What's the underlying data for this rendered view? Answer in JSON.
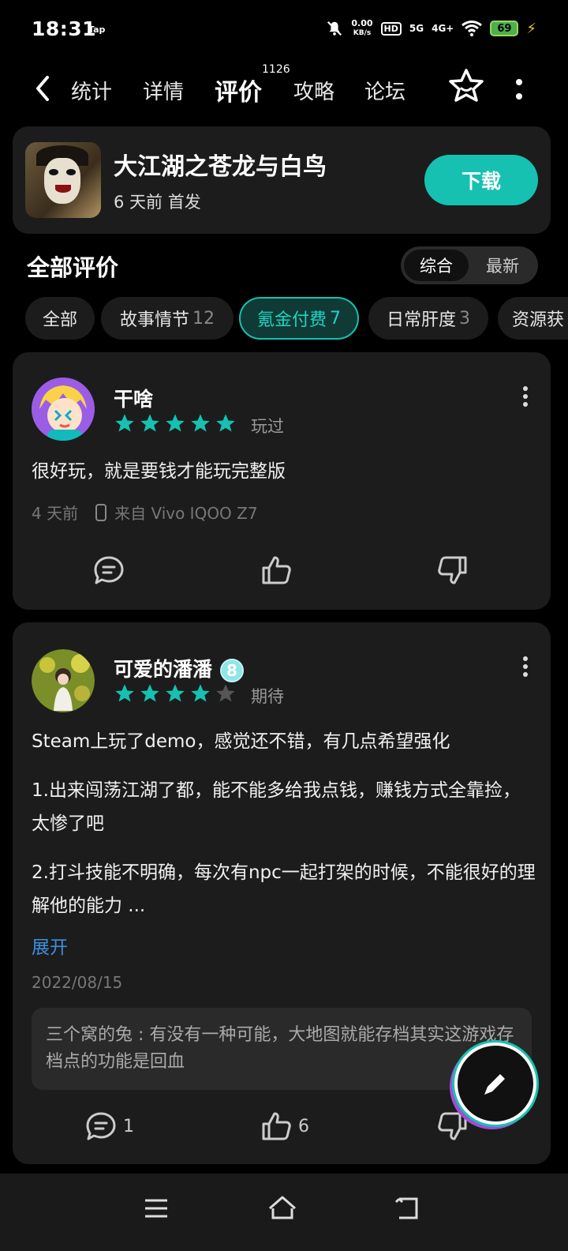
{
  "status_bar": {
    "time": "18:31",
    "tap": "Tap",
    "net_speed_value": "0.00",
    "net_speed_unit": "KB/s",
    "hd": "HD",
    "sig1": "5G",
    "sig2": "4G+",
    "battery": "69"
  },
  "nav": {
    "tabs": [
      "统计",
      "详情",
      "评价",
      "攻略",
      "论坛"
    ],
    "active_tab": "评价",
    "review_count": "1126"
  },
  "game": {
    "title": "大江湖之苍龙与白鸟",
    "subtitle": "6 天前 首发",
    "download_label": "下载"
  },
  "reviews_section": {
    "title": "全部评价",
    "sort_options": [
      "综合",
      "最新"
    ],
    "sort_selected": "综合"
  },
  "chips": [
    {
      "label": "全部",
      "count": ""
    },
    {
      "label": "故事情节",
      "count": "12"
    },
    {
      "label": "氪金付费",
      "count": "7"
    },
    {
      "label": "日常肝度",
      "count": "3"
    },
    {
      "label": "资源获",
      "count": ""
    }
  ],
  "reviews": [
    {
      "user": "干啥",
      "rating": 5,
      "status": "玩过",
      "text": "很好玩，就是要钱才能玩完整版",
      "time": "4 天前",
      "device": "来自 Vivo IQOO Z7",
      "comments": "",
      "likes": ""
    },
    {
      "user": "可爱的潘潘",
      "level": "8",
      "rating": 4,
      "status": "期待",
      "p1": "Steam上玩了demo，感觉还不错，有几点希望强化",
      "p2": "1.出来闯荡江湖了都，能不能多给我点钱，赚钱方式全靠捡，太惨了吧",
      "p3": "2.打斗技能不明确，每次有npc一起打架的时候，不能很好的理解他的能力 ...",
      "expand": "展开",
      "date": "2022/08/15",
      "reply_user": "三个窝的兔",
      "reply_text": "有没有一种可能，大地图就能存档其实这游戏存档点的功能是回血",
      "comments": "1",
      "likes": "6"
    }
  ],
  "colors": {
    "accent": "#16c1b1",
    "card_bg": "#1c1c1c",
    "link": "#3d8fe0"
  }
}
